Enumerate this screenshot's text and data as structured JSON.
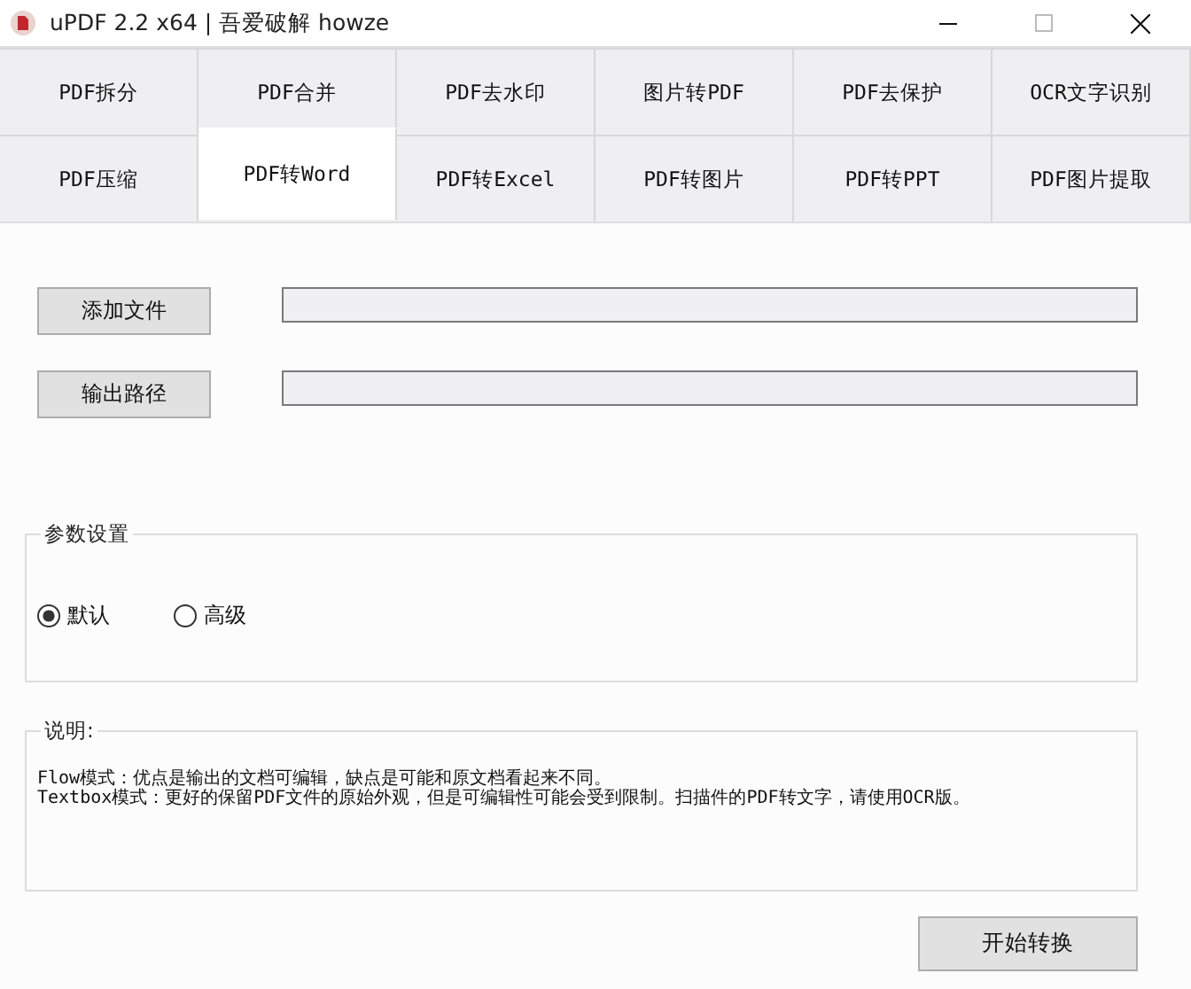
{
  "window": {
    "title": "uPDF 2.2 x64 | 吾爱破解 howze"
  },
  "tab_rows": [
    [
      {
        "label": "PDF拆分",
        "selected": false
      },
      {
        "label": "PDF合并",
        "selected": false
      },
      {
        "label": "PDF去水印",
        "selected": false
      },
      {
        "label": "图片转PDF",
        "selected": false
      },
      {
        "label": "PDF去保护",
        "selected": false
      },
      {
        "label": "OCR文字识别",
        "selected": false
      }
    ],
    [
      {
        "label": "PDF压缩",
        "selected": false
      },
      {
        "label": "PDF转Word",
        "selected": true
      },
      {
        "label": "PDF转Excel",
        "selected": false
      },
      {
        "label": "PDF转图片",
        "selected": false
      },
      {
        "label": "PDF转PPT",
        "selected": false
      },
      {
        "label": "PDF图片提取",
        "selected": false
      }
    ]
  ],
  "path_rows": [
    {
      "button": "添加文件"
    },
    {
      "button": "输出路径"
    }
  ],
  "settings": {
    "title": "参数设置",
    "options": [
      {
        "label": "默认",
        "selected": true
      },
      {
        "label": "高级",
        "selected": false
      }
    ]
  },
  "notes": {
    "title": "说明:",
    "lines": [
      "Flow模式：优点是输出的文档可编辑，缺点是可能和原文档看起来不同。",
      "Textbox模式：更好的保留PDF文件的原始外观，但是可编辑性可能会受到限制。扫描件的PDF转文字，请使用OCR版。"
    ]
  },
  "start_button": "开始转换"
}
